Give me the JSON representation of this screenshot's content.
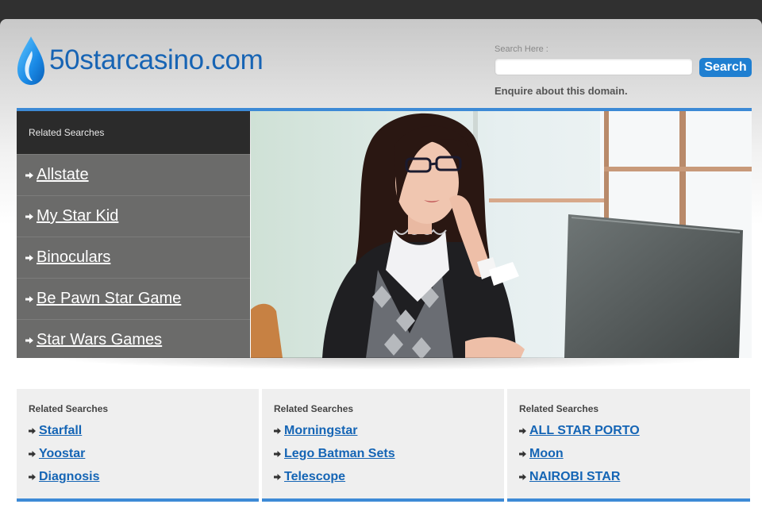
{
  "site": {
    "domain": "50starcasino.com"
  },
  "search": {
    "label": "Search Here :",
    "placeholder": "",
    "button_label": "Search",
    "enquire_text": "Enquire about this domain."
  },
  "colors": {
    "accent": "#1f7fd1",
    "link": "#1565b5",
    "panel_dark": "#2b2b2b",
    "panel": "#6b6b6a",
    "rule": "#3d8ad6"
  },
  "sidebar": {
    "title": "Related Searches",
    "items": [
      {
        "label": "Allstate",
        "icon": "arrow-right-icon"
      },
      {
        "label": "My Star Kid",
        "icon": "arrow-right-icon"
      },
      {
        "label": "Binoculars",
        "icon": "arrow-right-icon"
      },
      {
        "label": "Be Pawn Star Game",
        "icon": "arrow-right-icon"
      },
      {
        "label": "Star Wars Games",
        "icon": "arrow-right-icon"
      }
    ]
  },
  "columns": [
    {
      "title": "Related Searches",
      "links": [
        "Starfall",
        "Yoostar",
        "Diagnosis"
      ]
    },
    {
      "title": "Related Searches",
      "links": [
        "Morningstar",
        "Lego Batman Sets",
        "Telescope"
      ]
    },
    {
      "title": "Related Searches",
      "links": [
        "ALL STAR PORTO",
        "Moon",
        "NAIROBI STAR"
      ]
    }
  ]
}
